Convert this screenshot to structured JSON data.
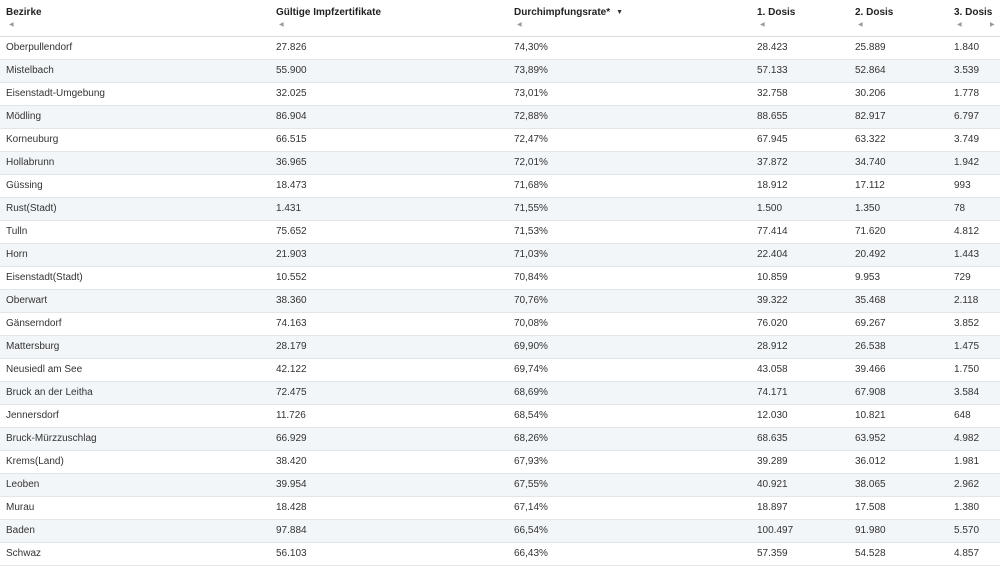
{
  "table": {
    "headers": [
      {
        "label": "Bezirke",
        "sort": ""
      },
      {
        "label": "Gültige Impfzertifikate",
        "sort": ""
      },
      {
        "label": "Durchimpfungsrate*",
        "sort": "▼"
      },
      {
        "label": "1. Dosis",
        "sort": ""
      },
      {
        "label": "2. Dosis",
        "sort": ""
      },
      {
        "label": "3. Dosis",
        "sort": ""
      }
    ],
    "rows": [
      [
        "Oberpullendorf",
        "27.826",
        "74,30%",
        "28.423",
        "25.889",
        "1.840"
      ],
      [
        "Mistelbach",
        "55.900",
        "73,89%",
        "57.133",
        "52.864",
        "3.539"
      ],
      [
        "Eisenstadt-Umgebung",
        "32.025",
        "73,01%",
        "32.758",
        "30.206",
        "1.778"
      ],
      [
        "Mödling",
        "86.904",
        "72,88%",
        "88.655",
        "82.917",
        "6.797"
      ],
      [
        "Korneuburg",
        "66.515",
        "72,47%",
        "67.945",
        "63.322",
        "3.749"
      ],
      [
        "Hollabrunn",
        "36.965",
        "72,01%",
        "37.872",
        "34.740",
        "1.942"
      ],
      [
        "Güssing",
        "18.473",
        "71,68%",
        "18.912",
        "17.112",
        "993"
      ],
      [
        "Rust(Stadt)",
        "1.431",
        "71,55%",
        "1.500",
        "1.350",
        "78"
      ],
      [
        "Tulln",
        "75.652",
        "71,53%",
        "77.414",
        "71.620",
        "4.812"
      ],
      [
        "Horn",
        "21.903",
        "71,03%",
        "22.404",
        "20.492",
        "1.443"
      ],
      [
        "Eisenstadt(Stadt)",
        "10.552",
        "70,84%",
        "10.859",
        "9.953",
        "729"
      ],
      [
        "Oberwart",
        "38.360",
        "70,76%",
        "39.322",
        "35.468",
        "2.118"
      ],
      [
        "Gänserndorf",
        "74.163",
        "70,08%",
        "76.020",
        "69.267",
        "3.852"
      ],
      [
        "Mattersburg",
        "28.179",
        "69,90%",
        "28.912",
        "26.538",
        "1.475"
      ],
      [
        "Neusiedl am See",
        "42.122",
        "69,74%",
        "43.058",
        "39.466",
        "1.750"
      ],
      [
        "Bruck an der Leitha",
        "72.475",
        "68,69%",
        "74.171",
        "67.908",
        "3.584"
      ],
      [
        "Jennersdorf",
        "11.726",
        "68,54%",
        "12.030",
        "10.821",
        "648"
      ],
      [
        "Bruck-Mürzzuschlag",
        "66.929",
        "68,26%",
        "68.635",
        "63.952",
        "4.982"
      ],
      [
        "Krems(Land)",
        "38.420",
        "67,93%",
        "39.289",
        "36.012",
        "1.981"
      ],
      [
        "Leoben",
        "39.954",
        "67,55%",
        "40.921",
        "38.065",
        "2.962"
      ],
      [
        "Murau",
        "18.428",
        "67,14%",
        "18.897",
        "17.508",
        "1.380"
      ],
      [
        "Baden",
        "97.884",
        "66,54%",
        "100.497",
        "91.980",
        "5.570"
      ],
      [
        "Schwaz",
        "56.103",
        "66,43%",
        "57.359",
        "54.528",
        "4.857"
      ]
    ]
  }
}
